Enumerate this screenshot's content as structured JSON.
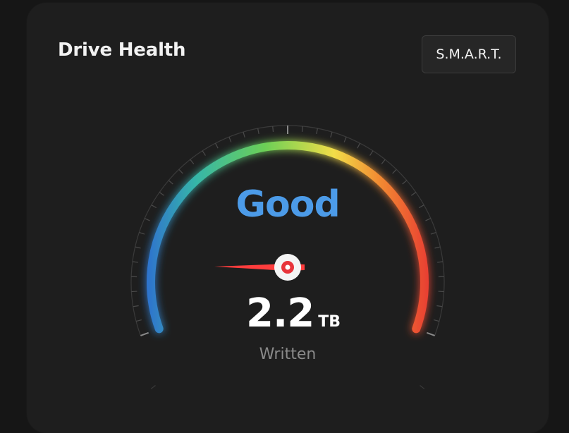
{
  "card": {
    "title": "Drive Health",
    "smart_button_label": "S.M.A.R.T."
  },
  "gauge": {
    "status_text": "Good",
    "value": "2.2",
    "unit": "TB",
    "caption": "Written",
    "colors": {
      "start": "#2e6fd0",
      "mid1": "#36b6a8",
      "mid2": "#6cd056",
      "mid3": "#f2dd48",
      "mid4": "#f28a32",
      "end": "#e83a30",
      "needle": "#ff3d3d",
      "status": "#4c9be8"
    }
  }
}
